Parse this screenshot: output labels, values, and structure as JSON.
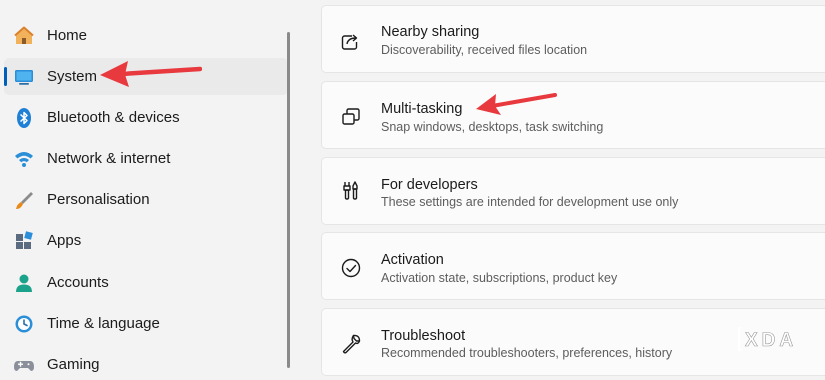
{
  "sidebar": {
    "items": [
      {
        "label": "Home",
        "icon": "home-icon"
      },
      {
        "label": "System",
        "icon": "system-monitor-icon"
      },
      {
        "label": "Bluetooth & devices",
        "icon": "bluetooth-icon"
      },
      {
        "label": "Network & internet",
        "icon": "wifi-icon"
      },
      {
        "label": "Personalisation",
        "icon": "paintbrush-icon"
      },
      {
        "label": "Apps",
        "icon": "apps-icon"
      },
      {
        "label": "Accounts",
        "icon": "person-icon"
      },
      {
        "label": "Time & language",
        "icon": "clock-globe-icon"
      },
      {
        "label": "Gaming",
        "icon": "gamepad-icon"
      }
    ],
    "selected": "System"
  },
  "cards": [
    {
      "title": "Nearby sharing",
      "subtitle": "Discoverability, received files location",
      "icon": "share-icon"
    },
    {
      "title": "Multi-tasking",
      "subtitle": "Snap windows, desktops, task switching",
      "icon": "multitask-windows-icon"
    },
    {
      "title": "For developers",
      "subtitle": "These settings are intended for development use only",
      "icon": "developer-tools-icon"
    },
    {
      "title": "Activation",
      "subtitle": "Activation state, subscriptions, product key",
      "icon": "checkmark-circle-icon"
    },
    {
      "title": "Troubleshoot",
      "subtitle": "Recommended troubleshooters, preferences, history",
      "icon": "wrench-icon"
    }
  ],
  "annotations": {
    "arrow_color": "#e8393f"
  },
  "watermark": {
    "text": "XDA"
  },
  "colors": {
    "accent": "#005fb8",
    "background": "#f3f3f3",
    "card": "#fbfbfb"
  }
}
